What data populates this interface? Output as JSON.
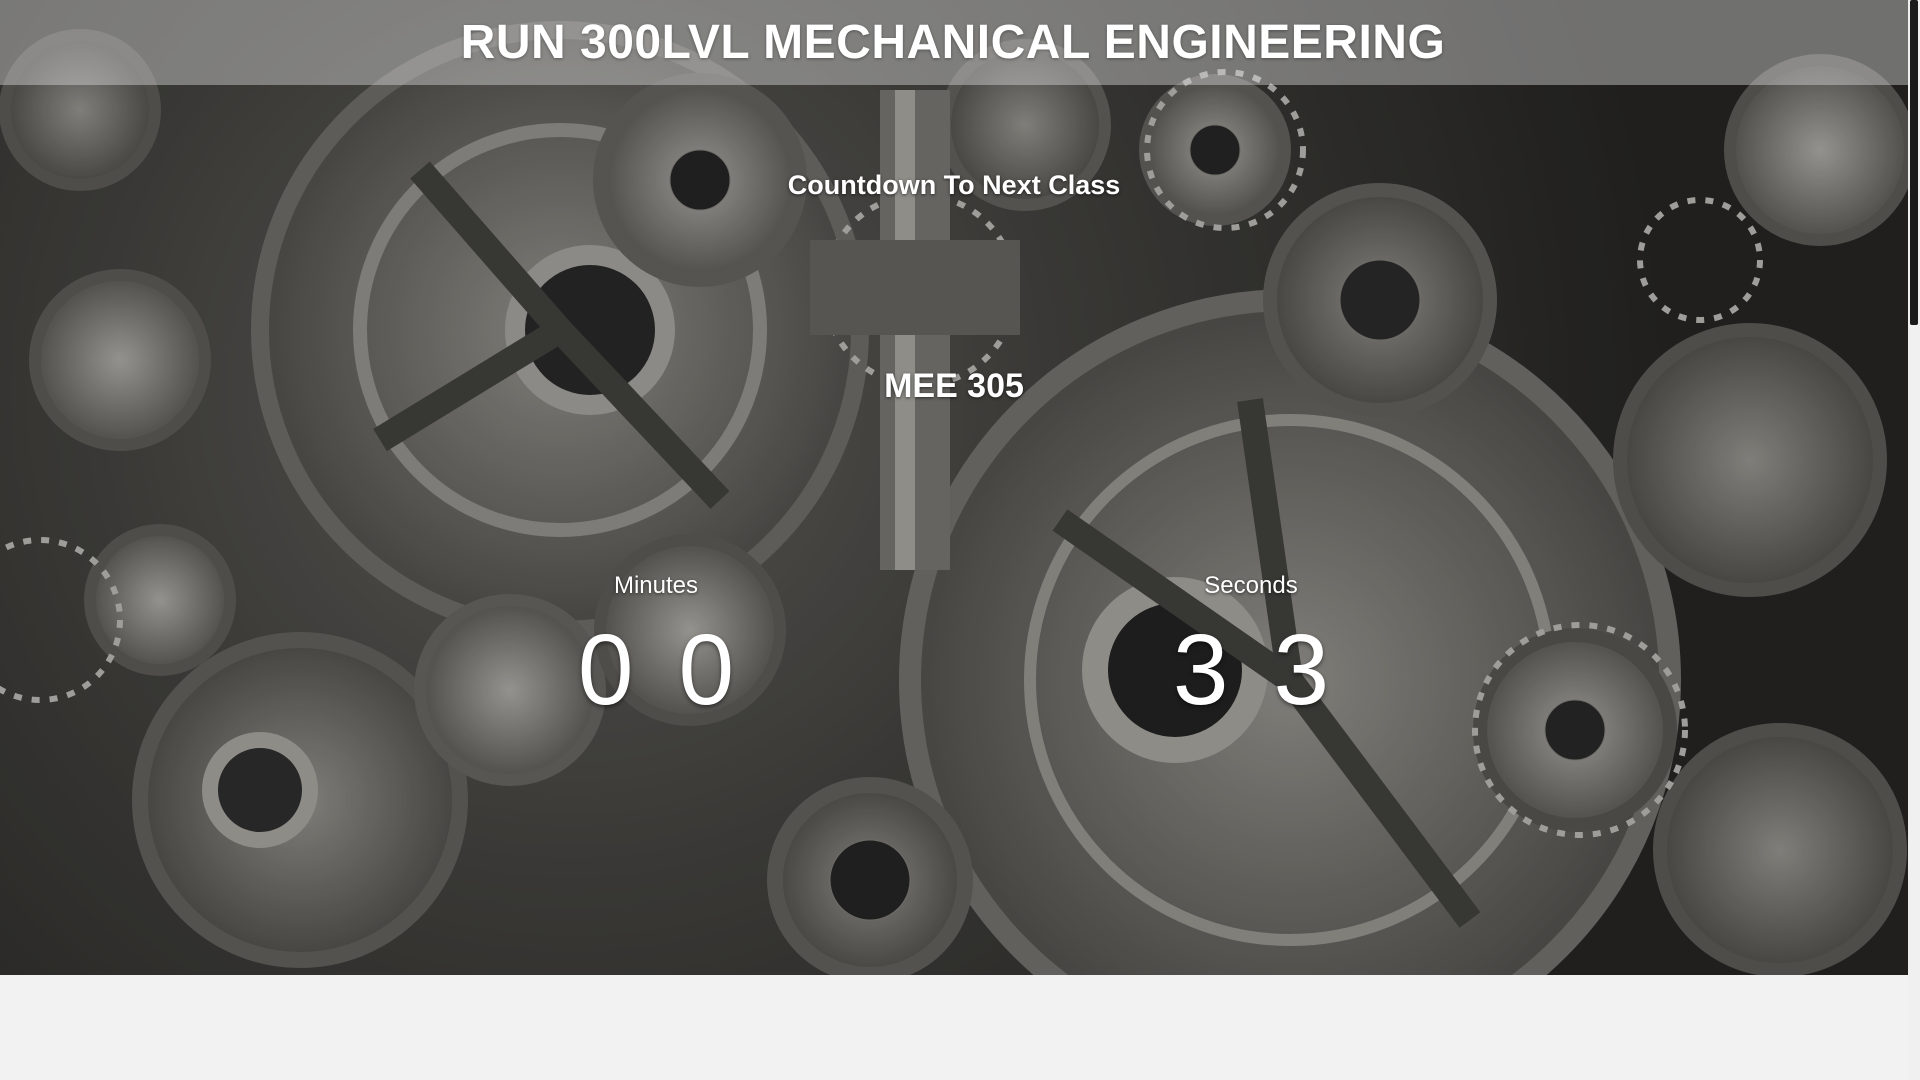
{
  "header": {
    "title": "RUN 300LVL MECHANICAL ENGINEERING"
  },
  "main": {
    "heading": "Countdown To Next Class",
    "course_code": "MEE 305",
    "countdown": {
      "minutes_label": "Minutes",
      "minutes_digits": [
        "0",
        "0"
      ],
      "seconds_label": "Seconds",
      "seconds_digits": [
        "3",
        "3"
      ]
    }
  },
  "colors": {
    "text": "#ffffff",
    "title_bar": "#e1e1e1",
    "page_bg": "#f2f2f2"
  }
}
